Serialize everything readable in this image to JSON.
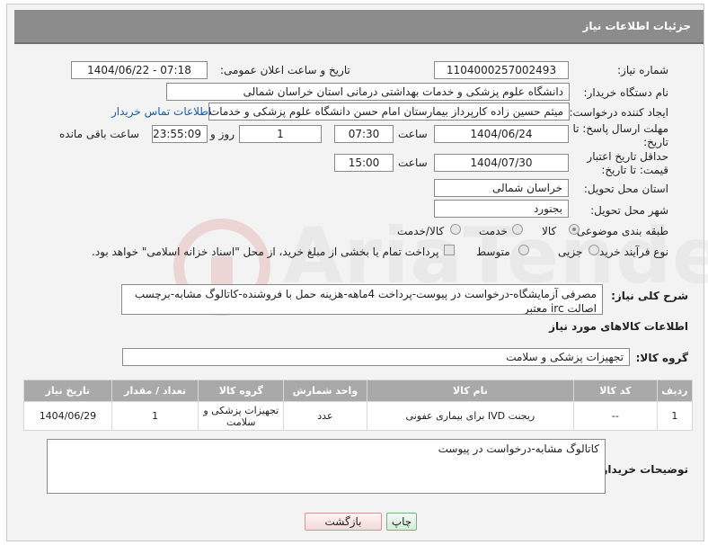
{
  "header": {
    "title": "جزئیات اطلاعات نیاز"
  },
  "fields": {
    "need_number_label": "شماره نیاز:",
    "need_number": "1104000257002493",
    "announce_label": "تاریخ و ساعت اعلان عمومی:",
    "announce_value": "1404/06/22 - 07:18",
    "buyer_label": "نام دستگاه خریدار:",
    "buyer_value": "دانشگاه علوم پزشکی و خدمات بهداشتی درمانی استان خراسان شمالی",
    "creator_label": "ایجاد کننده درخواست:",
    "creator_value": "میثم  حسین زاده  کارپرداز بیمارستان امام حسن دانشگاه علوم پزشکی و خدمات بهداشتی",
    "contact_link": "اطلاعات تماس خریدار",
    "reply_deadline_label": "مهلت ارسال پاسخ: تا تاریخ:",
    "reply_date": "1404/06/24",
    "time_label": "ساعت",
    "reply_time": "07:30",
    "days_value": "1",
    "days_label": "روز و",
    "remaining_value": "23:55:09",
    "remaining_label": "ساعت باقی مانده",
    "price_deadline_label": "حداقل تاریخ اعتبار قیمت: تا تاریخ:",
    "price_date": "1404/07/30",
    "price_time": "15:00",
    "province_label": "استان محل تحویل:",
    "province_value": "خراسان شمالی",
    "city_label": "شهر محل تحویل:",
    "city_value": "بجنورد",
    "category_label": "طبقه بندی موضوعی:",
    "cat_goods": "کالا",
    "cat_service": "خدمت",
    "cat_both": "کالا/خدمت",
    "process_label": "نوع فرآیند خرید :",
    "proc_partial": "جزیی",
    "proc_medium": "متوسط",
    "payment_note": "پرداخت تمام یا بخشی از مبلغ خرید، از محل \"اسناد خزانه اسلامی\" خواهد بود."
  },
  "description": {
    "label": "شرح کلی نیاز:",
    "text": "مصرفی آزمایشگاه-درخواست در پیوست-پرداخت 4ماهه-هزینه حمل با فروشنده-کاتالوگ مشابه-برچسب اصالت irc معتبر"
  },
  "goods": {
    "section_title": "اطلاعات کالاهای مورد نیاز",
    "group_label": "گروه کالا:",
    "group_value": "تجهیزات پزشکی و سلامت",
    "columns": [
      "ردیف",
      "کد کالا",
      "نام کالا",
      "واحد شمارش",
      "گروه کالا",
      "تعداد / مقدار",
      "تاریخ نیاز"
    ],
    "rows": [
      [
        "1",
        "--",
        "ریجنت IVD برای بیماری عفونی",
        "عدد",
        "تجهیزات پزشکی و سلامت",
        "1",
        "1404/06/29"
      ]
    ]
  },
  "buyer_notes": {
    "label": "توضیحات خریدار:",
    "text": "کاتالوگ مشابه-درخواست در پیوست"
  },
  "buttons": {
    "print": "چاپ",
    "back": "بازگشت"
  },
  "watermark": {
    "text": "AriaTender.neT"
  },
  "colors": {
    "header": "#8c8c8c",
    "table_header": "#a9a9a9",
    "link": "#1a5bb8"
  }
}
